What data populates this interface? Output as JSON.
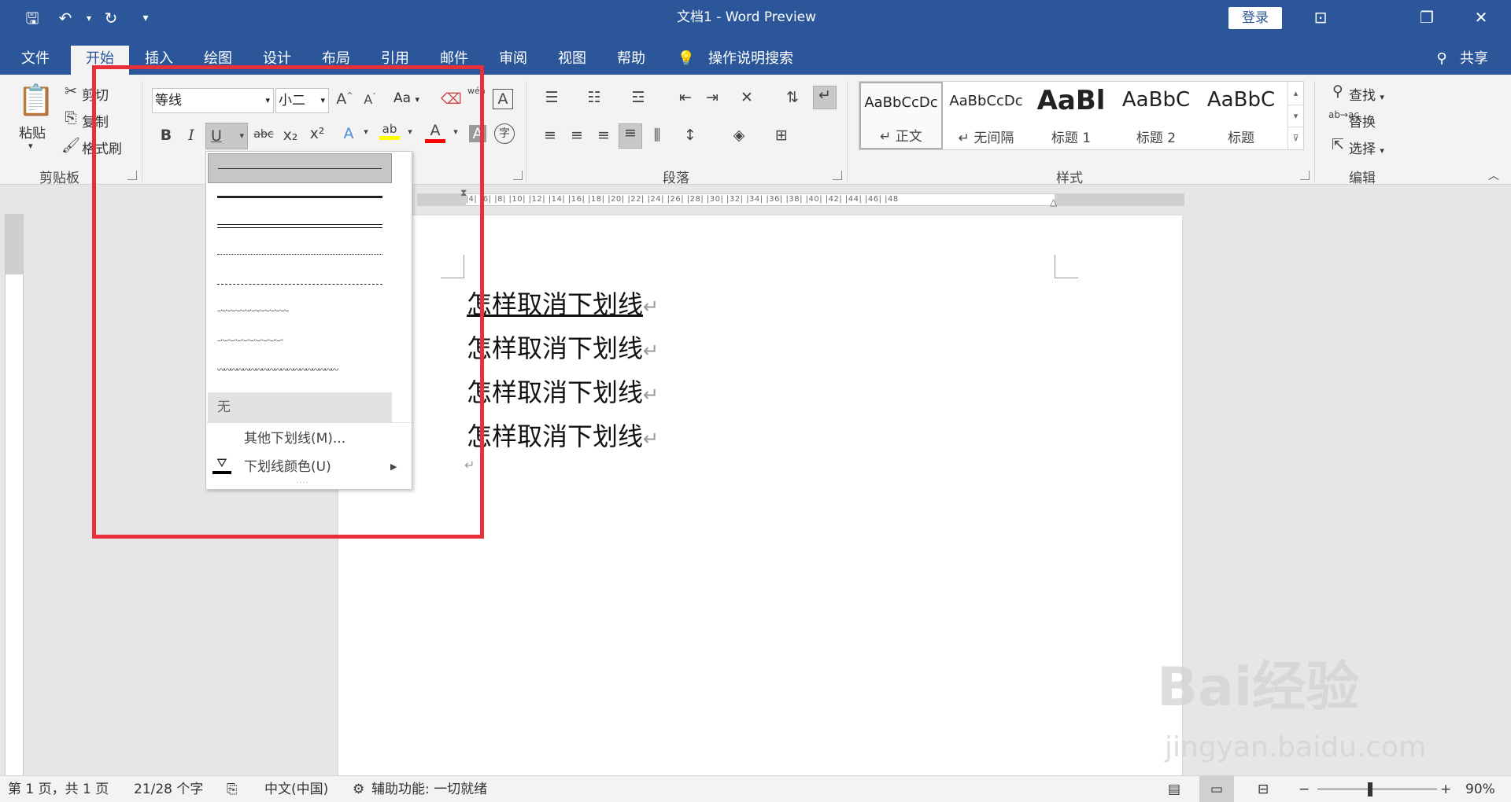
{
  "titlebar": {
    "doc_title": "文档1  -  Word Preview",
    "login_label": "登录",
    "qa_save": "🖫",
    "qa_undo": "↶",
    "qa_redo": "↻",
    "qa_customize": "▾",
    "icons": [
      "save-icon",
      "undo-icon",
      "redo-icon",
      "ribbon-display-icon",
      "restore-icon",
      "close-icon"
    ]
  },
  "tabs": [
    "文件",
    "开始",
    "插入",
    "绘图",
    "设计",
    "布局",
    "引用",
    "邮件",
    "审阅",
    "视图",
    "帮助"
  ],
  "active_tab": "开始",
  "tell_me": "操作说明搜索",
  "share": "共享",
  "clipboard": {
    "paste": "粘贴",
    "cut": "剪切",
    "copy": "复制",
    "format_painter": "格式刷",
    "group": "剪贴板"
  },
  "font": {
    "family": "等线",
    "size": "小二",
    "aa": "Aa",
    "bold": "B",
    "italic": "I",
    "underline": "U",
    "strike": "abc",
    "sub": "x₂",
    "sup": "x²",
    "color_a": "A",
    "wen": "wén",
    "char_border": "A",
    "enclose": "字"
  },
  "paragraph": {
    "group": "段落"
  },
  "styles": {
    "group": "样式",
    "items": [
      {
        "preview": "AaBbCcDc",
        "name": "↵ 正文"
      },
      {
        "preview": "AaBbCcDc",
        "name": "↵ 无间隔"
      },
      {
        "preview": "AaBl",
        "name": "标题 1"
      },
      {
        "preview": "AaBbC",
        "name": "标题 2"
      },
      {
        "preview": "AaBbC",
        "name": "标题"
      }
    ]
  },
  "editing": {
    "find": "查找",
    "replace": "替换",
    "select": "选择",
    "group": "编辑"
  },
  "underline_menu": {
    "none": "无",
    "more": "其他下划线(M)...",
    "color": "下划线颜色(U)"
  },
  "ruler_text": "|2|  |  |  |2|  |4|  |6|  |8|  |10|  |12|  |14|  |16|  |18|  |20|  |22|  |24|  |26|  |28|  |30|  |32|  |34|  |36|  |38|  |40|  |42|  |44|  |46|  |48",
  "document": {
    "lines": [
      "怎样取消下划线",
      "怎样取消下划线",
      "怎样取消下划线",
      "怎样取消下划线"
    ],
    "underlined_line": 0
  },
  "statusbar": {
    "page": "第 1 页，共 1 页",
    "words": "21/28 个字",
    "lang": "中文(中国)",
    "accessibility": "辅助功能: 一切就绪",
    "zoom": "90%",
    "zoom_minus": "−",
    "zoom_plus": "+"
  },
  "watermark": {
    "brand": "Bai经验",
    "url": "jingyan.baidu.com"
  },
  "colors": {
    "titlebar": "#2b579a",
    "ribbon": "#f3f3f3",
    "highlight": "#e8303a",
    "highlight_yellow": "#ffff00",
    "font_red": "#ff0000"
  }
}
